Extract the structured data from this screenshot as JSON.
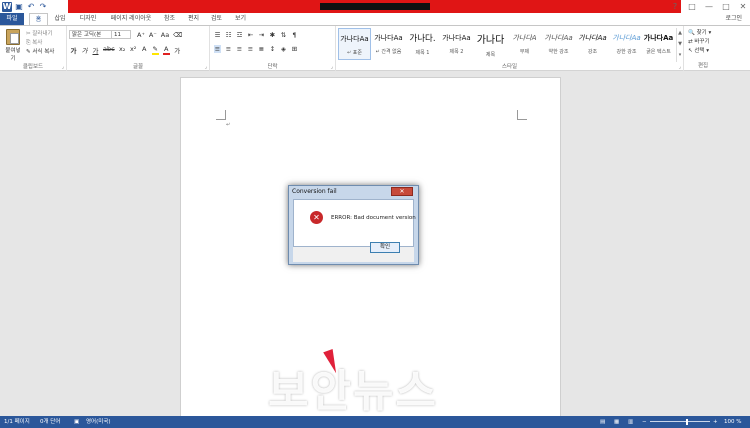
{
  "titlebar": {
    "qat_icons": [
      "word-logo-icon",
      "save-icon",
      "undo-icon",
      "redo-icon"
    ],
    "controls": [
      "?",
      "□",
      "—",
      "□",
      "✕"
    ]
  },
  "tabs": {
    "file": "파일",
    "home": "홈",
    "insert": "삽입",
    "design": "디자인",
    "layout": "페이지 레이아웃",
    "references": "참조",
    "mailings": "편지",
    "review": "검토",
    "view": "보기",
    "signin": "로그인"
  },
  "ribbon": {
    "clipboard": {
      "paste": "붙여넣기",
      "cut": "잘라내기",
      "copy": "복사",
      "format_painter": "서식 복사",
      "label": "클립보드"
    },
    "font": {
      "font_name": "맑은 고딕(본",
      "font_size": "11",
      "label": "글꼴"
    },
    "paragraph": {
      "label": "단락"
    },
    "styles": {
      "label": "스타일",
      "items": [
        {
          "sample": "가나다Aa",
          "name": "↵ 표준"
        },
        {
          "sample": "가나다Aa",
          "name": "↵ 간격 없음"
        },
        {
          "sample": "가나다.",
          "name": "제목 1"
        },
        {
          "sample": "가나다Aa",
          "name": "제목 2"
        },
        {
          "sample": "가나다",
          "name": "제목"
        },
        {
          "sample": "가나다A",
          "name": "부제"
        },
        {
          "sample": "가나다Aa",
          "name": "약한 강조"
        },
        {
          "sample": "가나다Aa",
          "name": "강조"
        },
        {
          "sample": "가나다Aa",
          "name": "강한 강조"
        },
        {
          "sample": "가나다Aa",
          "name": "굵은 텍스트"
        }
      ]
    },
    "editing": {
      "find": "찾기",
      "replace": "바꾸기",
      "select": "선택",
      "label": "편집"
    }
  },
  "dialog": {
    "title": "Conversion fail",
    "close": "✕",
    "message": "ERROR: Bad document version",
    "ok": "확인"
  },
  "watermark": "보안뉴스",
  "statusbar": {
    "page": "1/1 페이지",
    "words": "0개 단어",
    "language": "영어(미국)",
    "zoom": "100 %"
  },
  "colors": {
    "accent": "#2b579a",
    "title_band": "#e01515",
    "error_icon": "#c8282a"
  }
}
